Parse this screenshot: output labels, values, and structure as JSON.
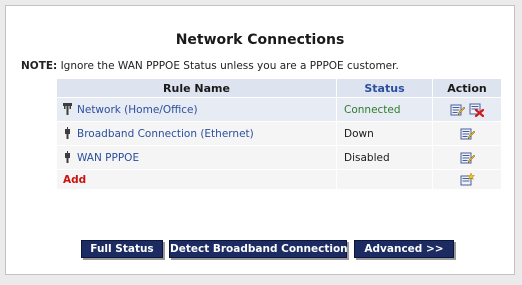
{
  "page": {
    "title": "Network Connections",
    "note_label": "NOTE:",
    "note_text": " Ignore the WAN PPPOE Status unless you are a PPPOE customer."
  },
  "table": {
    "headers": {
      "name": "Rule Name",
      "status": "Status",
      "action": "Action"
    },
    "rows": [
      {
        "name": "Network (Home/Office)",
        "status": "Connected",
        "icon": "network-plug-icon",
        "actions": [
          "edit-icon",
          "delete-icon"
        ]
      },
      {
        "name": "Broadband Connection (Ethernet)",
        "status": "Down",
        "icon": "plug-icon",
        "actions": [
          "edit-icon"
        ]
      },
      {
        "name": "WAN PPPOE",
        "status": "Disabled",
        "icon": "plug-icon",
        "actions": [
          "edit-icon"
        ]
      }
    ],
    "add_label": "Add",
    "add_action": "add-icon"
  },
  "buttons": {
    "full_status": "Full Status",
    "detect": "Detect Broadband Connection",
    "advanced": "Advanced >>"
  },
  "colors": {
    "header_bg": "#dde3ef",
    "link": "#2b4f9e",
    "connected": "#2e7d2e",
    "add": "#cc1111",
    "button_bg": "#1c2c63"
  }
}
